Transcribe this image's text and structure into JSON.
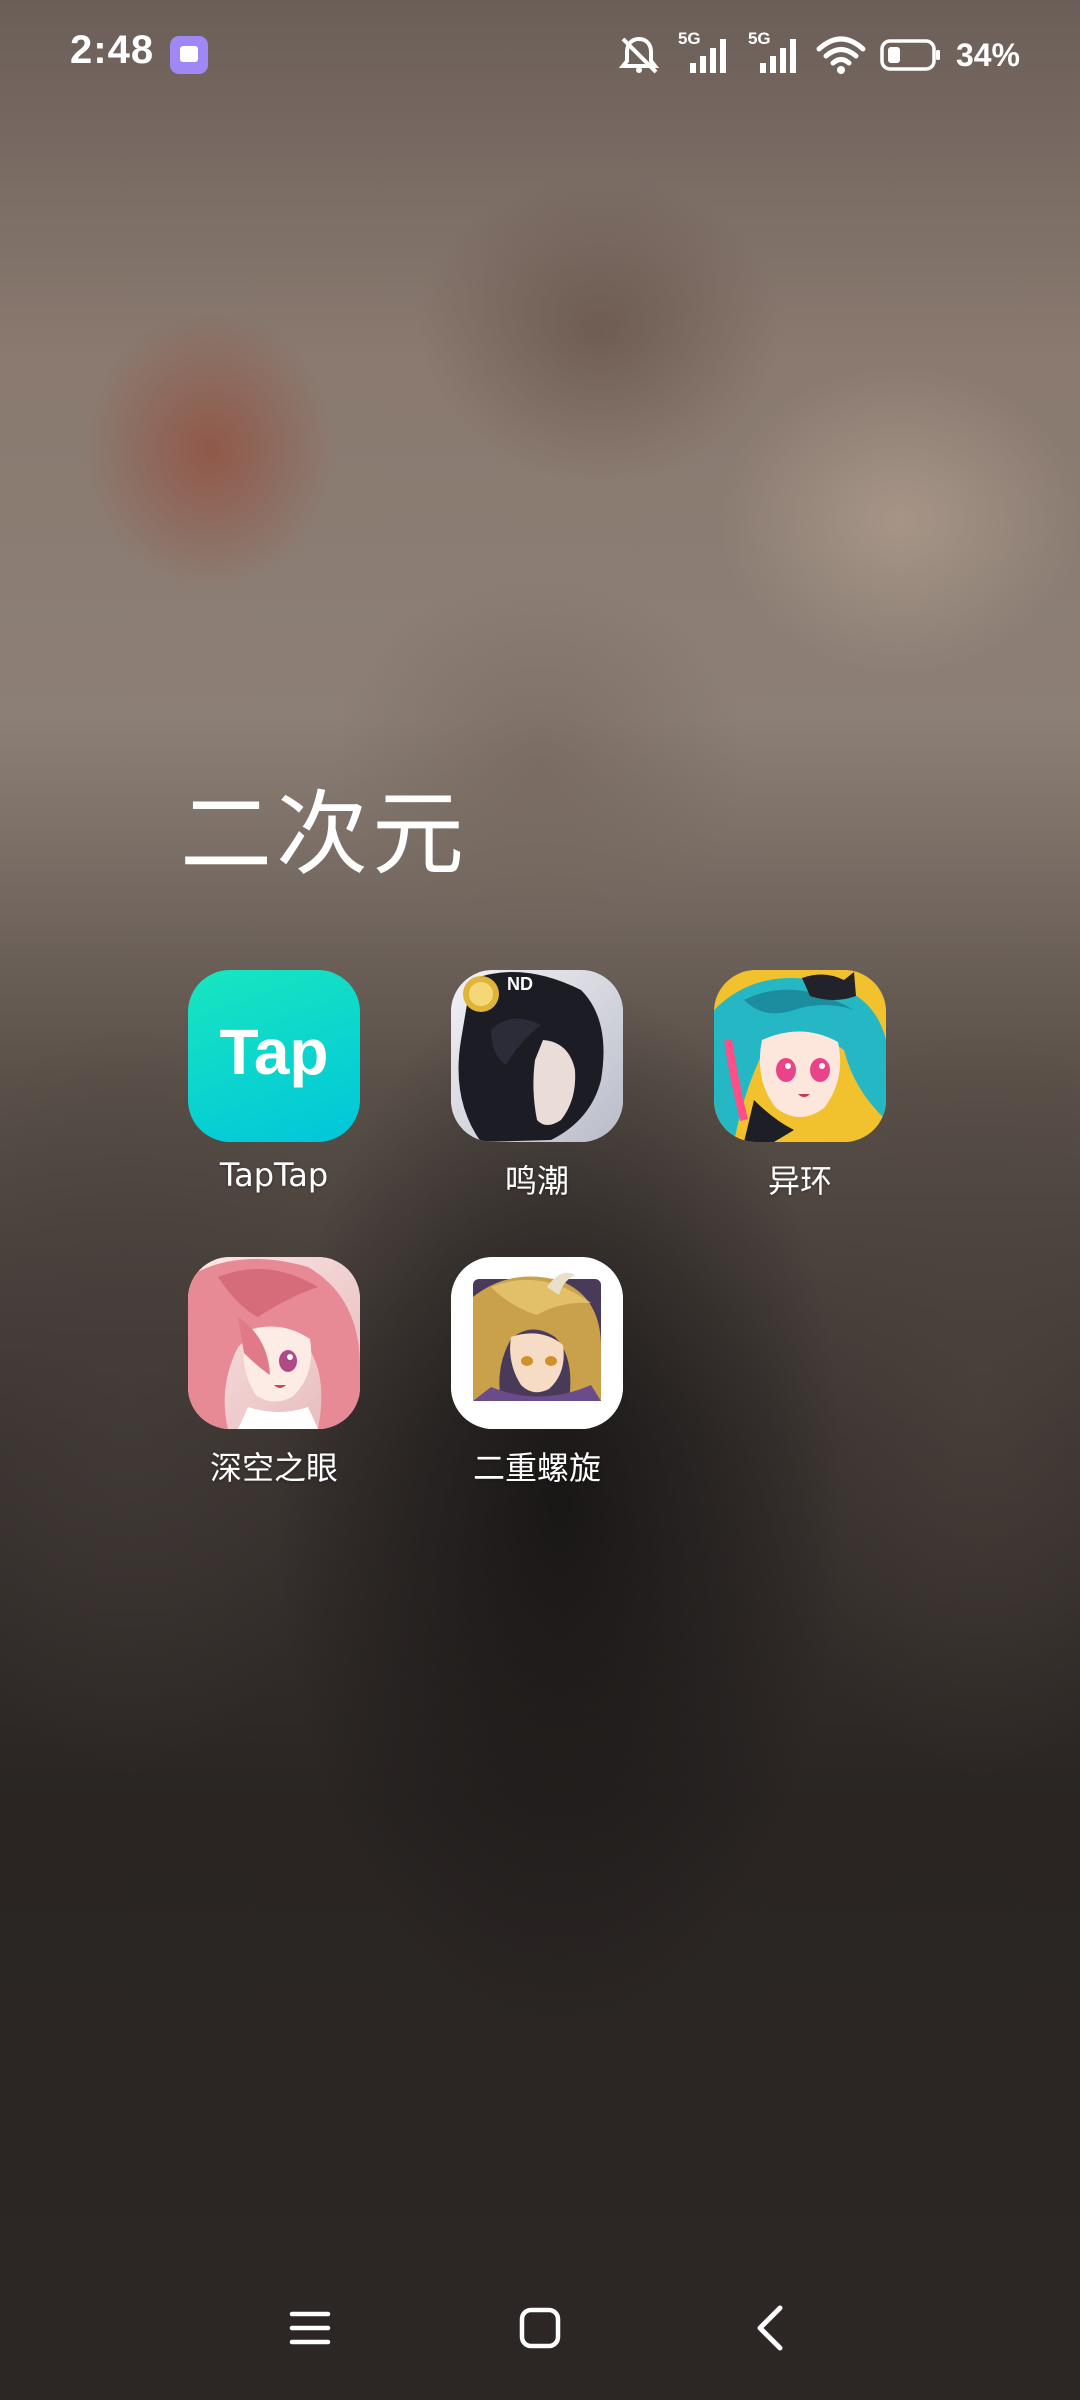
{
  "status_bar": {
    "time": "2:48",
    "network_1": "5G",
    "network_2": "5G",
    "battery_percent": "34%",
    "icons": [
      "app-badge-icon",
      "mute-icon",
      "signal-icon",
      "signal-icon",
      "wifi-icon",
      "battery-icon"
    ]
  },
  "folder": {
    "title": "二次元",
    "apps": [
      {
        "label": "TapTap",
        "icon": "taptap-icon",
        "icon_text": "Tap"
      },
      {
        "label": "鸣潮",
        "icon": "wuthering-waves-icon",
        "icon_text": "ND"
      },
      {
        "label": "异环",
        "icon": "neverness-icon"
      },
      {
        "label": "深空之眼",
        "icon": "aether-gazer-icon"
      },
      {
        "label": "二重螺旋",
        "icon": "duet-night-abyss-icon"
      }
    ]
  },
  "nav_bar": {
    "icons": [
      "menu-icon",
      "home-icon",
      "back-icon"
    ]
  },
  "colors": {
    "taptap_start": "#14e2c4",
    "taptap_end": "#00c8d8",
    "badge": "#9f87f5"
  }
}
